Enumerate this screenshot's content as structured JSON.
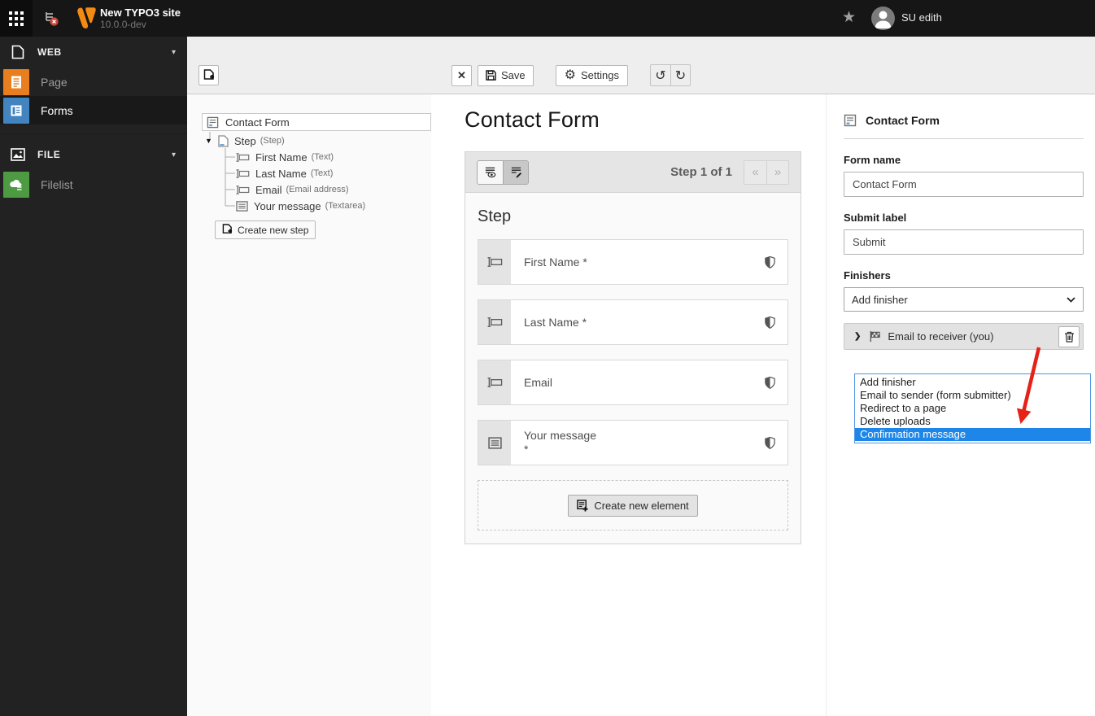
{
  "topbar": {
    "site_title": "New TYPO3 site",
    "site_version": "10.0.0-dev",
    "username": "SU edith"
  },
  "sidebar": {
    "sections": [
      {
        "label": "WEB",
        "items": [
          {
            "label": "Page"
          },
          {
            "label": "Forms"
          }
        ]
      },
      {
        "label": "FILE",
        "items": [
          {
            "label": "Filelist"
          }
        ]
      }
    ]
  },
  "toolbar": {
    "close_label": "✕",
    "save_label": "Save",
    "settings_label": "Settings"
  },
  "tree": {
    "root_label": "Contact Form",
    "step_label": "Step",
    "step_type": "(Step)",
    "children": [
      {
        "label": "First Name",
        "type": "(Text)"
      },
      {
        "label": "Last Name",
        "type": "(Text)"
      },
      {
        "label": "Email",
        "type": "(Email address)"
      },
      {
        "label": "Your message",
        "type": "(Textarea)"
      }
    ],
    "create_step_label": "Create new step"
  },
  "stage": {
    "title": "Contact Form",
    "paginator": "Step 1 of 1",
    "prev_glyph": "«",
    "next_glyph": "»",
    "step_heading": "Step",
    "elements": [
      {
        "label": "First Name *"
      },
      {
        "label": "Last Name *"
      },
      {
        "label": "Email"
      },
      {
        "label": "Your message",
        "second_line": "*"
      }
    ],
    "create_element_label": "Create new element"
  },
  "inspector": {
    "header_title": "Contact Form",
    "form_name_label": "Form name",
    "form_name_value": "Contact Form",
    "submit_label_label": "Submit label",
    "submit_label_value": "Submit",
    "finishers_label": "Finishers",
    "finisher_select_value": "Add finisher",
    "finisher_item_label": "Email to receiver (you)",
    "dropdown_options": [
      "Add finisher",
      "Email to sender (form submitter)",
      "Redirect to a page",
      "Delete uploads",
      "Confirmation message"
    ],
    "dropdown_selected": "Confirmation message"
  },
  "icons": {
    "caret_down": "▼",
    "section_caret": "▾",
    "chevron_right": "❯",
    "undo": "↺",
    "redo": "↻",
    "gear": "⚙",
    "star": "★"
  },
  "colors": {
    "accent_orange": "#e87e1e",
    "module_blue": "#4284bf",
    "module_green": "#4e9a42",
    "select_highlight": "#1e86e8",
    "arrow_red": "#e62117"
  }
}
